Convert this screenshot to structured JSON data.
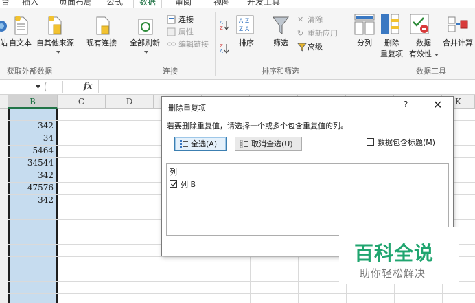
{
  "menubar": {
    "tabs": [
      {
        "label": "台"
      },
      {
        "label": "插入"
      },
      {
        "label": "页面布局"
      },
      {
        "label": "公式"
      },
      {
        "label": "数据"
      },
      {
        "label": "审阅"
      },
      {
        "label": "视图"
      },
      {
        "label": "开发工具"
      }
    ],
    "active_tab": "数据"
  },
  "ribbon": {
    "get_external": {
      "web_partial": "站",
      "from_text": "自文本",
      "from_other": "自其他来源",
      "existing": "现有连接",
      "group_label": "获取外部数据"
    },
    "connections": {
      "refresh_all": "全部刷新",
      "connections": "连接",
      "properties": "属性",
      "edit_links": "编辑链接",
      "group_label": "连接"
    },
    "sort_filter": {
      "sort": "排序",
      "filter": "筛选",
      "clear": "清除",
      "reapply": "重新应用",
      "advanced": "高级",
      "group_label": "排序和筛选"
    },
    "data_tools": {
      "text_to_columns": "分列",
      "remove_dup_line1": "删除",
      "remove_dup_line2": "重复项",
      "validation_line1": "数据",
      "validation_line2": "有效性",
      "consolidate": "合并计算",
      "group_label": "数据工具"
    }
  },
  "formula_bar": {
    "fx_label": "fx",
    "value": ""
  },
  "sheet": {
    "columns": [
      "B",
      "C",
      "D",
      "",
      "",
      "",
      "",
      "",
      "",
      "K"
    ],
    "selected_column": "B",
    "column_b_values": [
      "342",
      "34",
      "5464",
      "34544",
      "342",
      "47576",
      "342"
    ]
  },
  "dialog": {
    "title": "删除重复项",
    "help": "?",
    "close": "✕",
    "prompt": "若要删除重复值，请选择一个或多个包含重复值的列。",
    "select_all": "全选(A)",
    "unselect_all": "取消全选(U)",
    "has_headers": "数据包含标题(M)",
    "has_headers_checked": false,
    "list_header": "列",
    "columns": [
      {
        "label": "列 B",
        "checked": true
      }
    ]
  },
  "watermark": {
    "brand": "百科全说",
    "slogan": "助你轻松解决"
  },
  "colors": {
    "selection_fill": "#c6dcef",
    "accent_green": "#217346",
    "watermark_green": "#20a56f"
  }
}
